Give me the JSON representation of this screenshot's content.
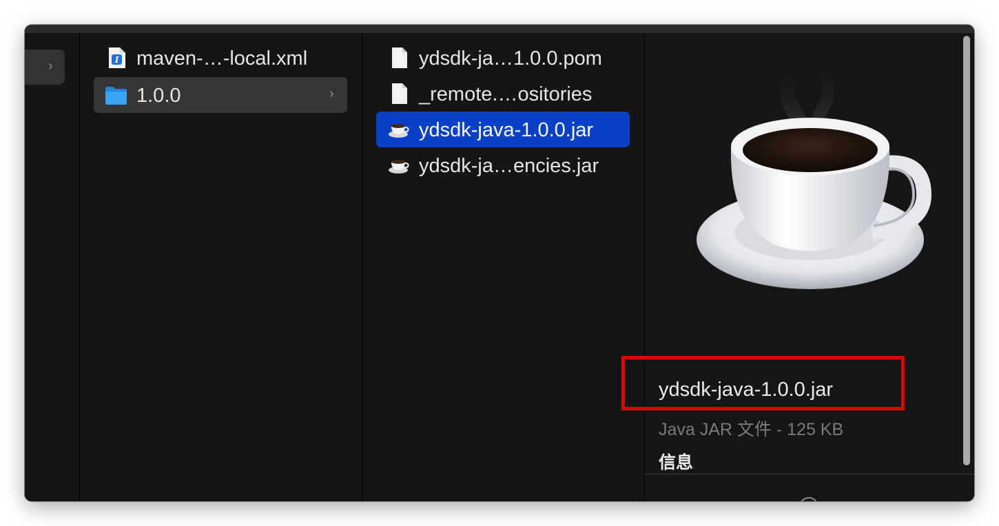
{
  "column1": {
    "items": [
      {
        "label": "maven-…-local.xml",
        "icon": "xml-document-icon"
      },
      {
        "label": "1.0.0",
        "icon": "folder-icon"
      }
    ]
  },
  "column2": {
    "items": [
      {
        "label": "ydsdk-ja…1.0.0.pom",
        "icon": "document-icon"
      },
      {
        "label": "_remote.…ositories",
        "icon": "document-icon"
      },
      {
        "label": "ydsdk-java-1.0.0.jar",
        "icon": "java-cup-icon"
      },
      {
        "label": "ydsdk-ja…encies.jar",
        "icon": "java-cup-icon"
      }
    ]
  },
  "preview": {
    "name": "ydsdk-java-1.0.0.jar",
    "kind_size": "Java JAR 文件 - 125 KB",
    "info_heading": "信息"
  },
  "colors": {
    "selection": "#0840c8",
    "annotation": "#e00000",
    "folder": "#2d9cf0"
  }
}
